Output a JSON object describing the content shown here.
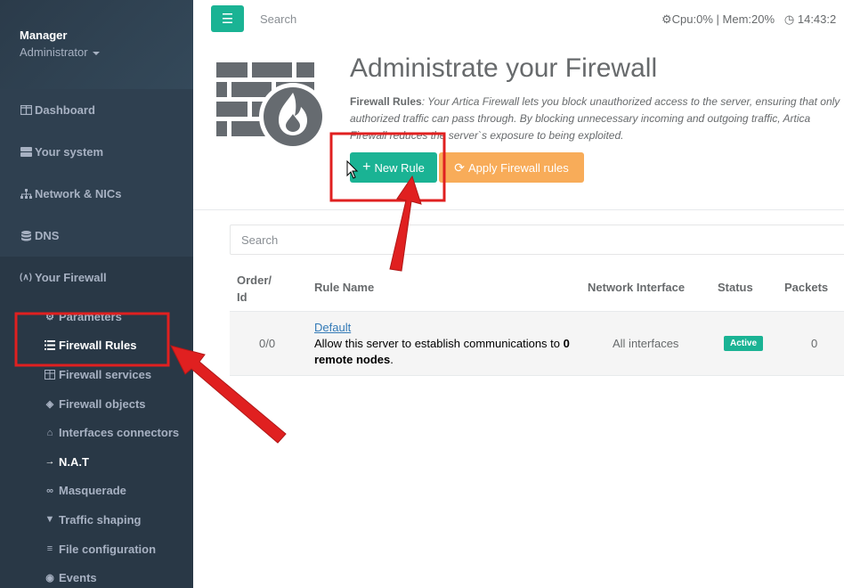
{
  "sidebar": {
    "user_name": "Manager",
    "user_role": "Administrator",
    "items": [
      {
        "label": "Dashboard",
        "icon": "columns-icon"
      },
      {
        "label": "Your system",
        "icon": "server-icon"
      },
      {
        "label": "Network & NICs",
        "icon": "sitemap-icon"
      },
      {
        "label": "DNS",
        "icon": "database-icon"
      },
      {
        "label": "Your Firewall",
        "icon": "firewall-icon"
      }
    ],
    "submenu": [
      {
        "label": "Parameters",
        "icon": "gears-icon"
      },
      {
        "label": "Firewall Rules",
        "icon": "list-icon"
      },
      {
        "label": "Firewall services",
        "icon": "table-icon"
      },
      {
        "label": "Firewall objects",
        "icon": "cubes-icon"
      },
      {
        "label": "Interfaces connectors",
        "icon": "router-icon"
      },
      {
        "label": "N.A.T",
        "icon": "arrow-right-icon"
      },
      {
        "label": "Masquerade",
        "icon": "mask-icon"
      },
      {
        "label": "Traffic shaping",
        "icon": "filter-icon"
      },
      {
        "label": "File configuration",
        "icon": "bars-icon"
      },
      {
        "label": "Events",
        "icon": "eye-icon"
      }
    ]
  },
  "topbar": {
    "search_placeholder": "Search",
    "cpu": "Cpu:0%",
    "mem": "Mem:20%",
    "time": "14:43:2"
  },
  "header": {
    "title": "Administrate your Firewall",
    "desc_label": "Firewall Rules",
    "desc_text": ": Your Artica Firewall lets you block unauthorized access to the server, ensuring that only authorized traffic can pass through. By blocking unnecessary incoming and outgoing traffic, Artica Firewall reduces the server`s exposure to being exploited.",
    "new_rule_label": "New Rule",
    "apply_label": "Apply Firewall rules"
  },
  "table": {
    "search_placeholder": "Search",
    "columns": {
      "order": "Order/ Id",
      "name": "Rule Name",
      "nic": "Network Interface",
      "status": "Status",
      "packets": "Packets"
    },
    "rows": [
      {
        "order": "0/0",
        "name": "Default",
        "desc_pre": "Allow this server to establish communications to ",
        "desc_bold1": "0",
        "desc_bold2": "remote nodes",
        "desc_post": ".",
        "nic": "All interfaces",
        "status": "Active",
        "packets": "0"
      }
    ]
  },
  "colors": {
    "sidebar_bg": "#2f4050",
    "primary": "#1ab394",
    "warning": "#f8ac59",
    "annotation_red": "#e02020"
  }
}
